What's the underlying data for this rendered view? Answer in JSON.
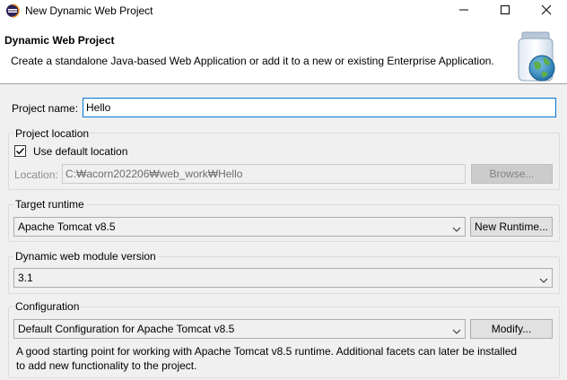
{
  "window": {
    "title": "New Dynamic Web Project",
    "controls": {
      "minimize_icon": "minimize-icon",
      "maximize_icon": "maximize-icon",
      "close_icon": "close-icon"
    }
  },
  "banner": {
    "title": "Dynamic Web Project",
    "description": "Create a standalone Java-based Web Application or add it to a new or existing Enterprise Application.",
    "image_icon": "jar-globe-icon"
  },
  "project_name": {
    "label": "Project name:",
    "value": "Hello"
  },
  "project_location": {
    "group_label": "Project location",
    "use_default_label": "Use default location",
    "use_default_checked": true,
    "location_label": "Location:",
    "location_value": "C:₩acorn202206₩web_work₩Hello",
    "browse_label": "Browse..."
  },
  "target_runtime": {
    "group_label": "Target runtime",
    "selected": "Apache Tomcat v8.5",
    "new_runtime_label": "New Runtime..."
  },
  "module_version": {
    "group_label": "Dynamic web module version",
    "selected": "3.1"
  },
  "configuration": {
    "group_label": "Configuration",
    "selected": "Default Configuration for Apache Tomcat v8.5",
    "modify_label": "Modify...",
    "description_line1": "A good starting point for working with Apache Tomcat v8.5 runtime. Additional facets can later be installed",
    "description_line2": "to add new functionality to the project."
  },
  "colors": {
    "focus_border": "#0078d7",
    "window_bg": "#f0f0f0",
    "banner_bg": "#ffffff"
  }
}
